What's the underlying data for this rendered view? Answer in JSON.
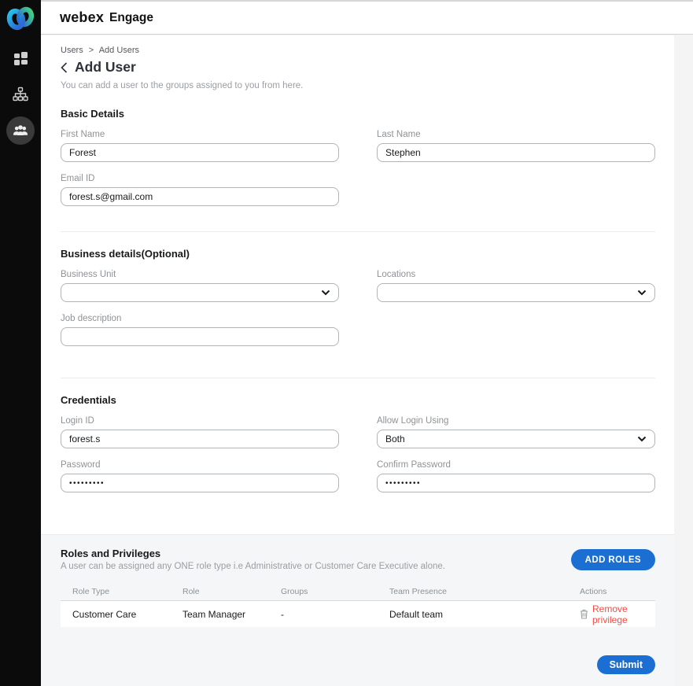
{
  "header": {
    "brand_bold": "webex",
    "brand_regular": "Engage"
  },
  "sidebar": {
    "icons": [
      {
        "name": "grid-icon"
      },
      {
        "name": "org-chart-icon"
      },
      {
        "name": "team-icon",
        "active": true
      }
    ]
  },
  "breadcrumb": {
    "items": [
      "Users",
      "Add Users"
    ],
    "separator": ">"
  },
  "page": {
    "title": "Add User",
    "subtitle": "You can add a user to the groups assigned to you from here."
  },
  "basic_details": {
    "heading": "Basic Details",
    "first_name": {
      "label": "First Name",
      "value": "Forest"
    },
    "last_name": {
      "label": "Last Name",
      "value": "Stephen"
    },
    "email": {
      "label": "Email ID",
      "value": "forest.s@gmail.com"
    }
  },
  "business_details": {
    "heading": "Business details(Optional)",
    "business_unit": {
      "label": "Business Unit",
      "value": ""
    },
    "locations": {
      "label": "Locations",
      "value": ""
    },
    "job_description": {
      "label": "Job description",
      "value": ""
    }
  },
  "credentials": {
    "heading": "Credentials",
    "login_id": {
      "label": "Login ID",
      "value": "forest.s"
    },
    "allow_login": {
      "label": "Allow Login Using",
      "value": "Both"
    },
    "password": {
      "label": "Password",
      "value": "•••••••••"
    },
    "confirm_password": {
      "label": "Confirm Password",
      "value": "•••••••••"
    }
  },
  "roles": {
    "heading": "Roles and Privileges",
    "subtitle": "A user can be assigned any ONE role type i.e Administrative or Customer Care Executive alone.",
    "add_button": "ADD ROLES",
    "table": {
      "headers": [
        "Role Type",
        "Role",
        "Groups",
        "Team Presence",
        "Actions"
      ],
      "rows": [
        {
          "role_type": "Customer Care",
          "role": "Team Manager",
          "groups": "-",
          "team_presence": "Default team",
          "action": "Remove privilege"
        }
      ]
    }
  },
  "footer": {
    "submit": "Submit"
  },
  "colors": {
    "accent_blue": "#1b6fd3",
    "danger_red": "#f04e43",
    "sidebar_black": "#0b0b0b"
  }
}
